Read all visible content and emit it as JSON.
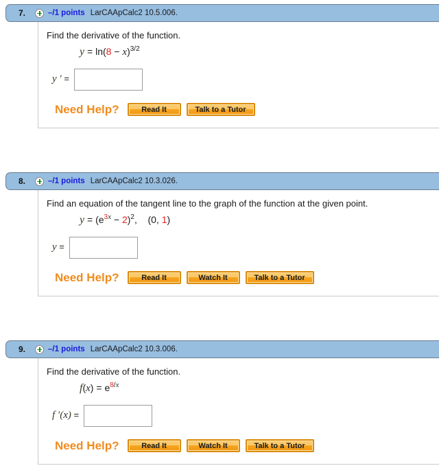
{
  "page": {
    "title": "Homework assignment questions 7-9"
  },
  "questions": [
    {
      "number": "7.",
      "status_icon": "plus-circle-icon",
      "points": "–/1 points",
      "reference": "LarCAApCalc2 10.5.006.",
      "prompt": "Find the derivative of the function.",
      "equation_plain": "y = ln(8 − x)^(3/2)",
      "answer_label": "y ' =",
      "answer_value": "",
      "help_label": "Need Help?",
      "buttons": [
        "Read It",
        "Talk to a Tutor"
      ]
    },
    {
      "number": "8.",
      "status_icon": "plus-circle-icon",
      "points": "–/1 points",
      "reference": "LarCAApCalc2 10.3.026.",
      "prompt": "Find an equation of the tangent line to the graph of the function at the given point.",
      "equation_plain": "y = (e^(3x) − 2)^2,    (0, 1)",
      "answer_label": "y =",
      "answer_value": "",
      "help_label": "Need Help?",
      "buttons": [
        "Read It",
        "Watch It",
        "Talk to a Tutor"
      ]
    },
    {
      "number": "9.",
      "status_icon": "plus-circle-icon",
      "points": "–/1 points",
      "reference": "LarCAApCalc2 10.3.006.",
      "prompt": "Find the derivative of the function.",
      "equation_plain": "f(x) = e^(8/x)",
      "answer_label": "f '(x) =",
      "answer_value": "",
      "help_label": "Need Help?",
      "buttons": [
        "Read It",
        "Watch It",
        "Talk to a Tutor"
      ]
    }
  ],
  "colors": {
    "header_bar": "#97bddf",
    "points_text": "#1b1bdd",
    "help_label": "#f08c1e",
    "button_orange": "#f5a623",
    "red_constant": "#e02020"
  }
}
